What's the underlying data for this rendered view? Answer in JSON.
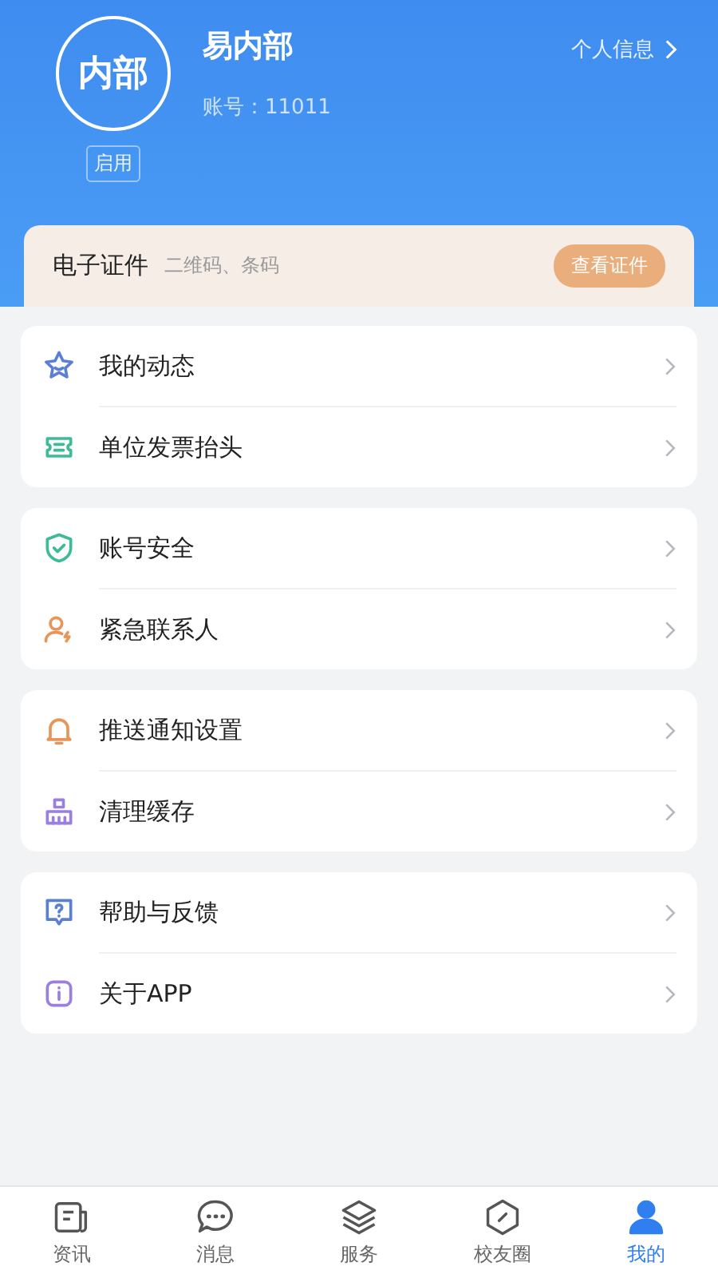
{
  "profile": {
    "avatar_text": "内部",
    "name": "易内部",
    "account": "账号：11011",
    "status": "启用",
    "info_link": "个人信息"
  },
  "id_card": {
    "title": "电子证件",
    "subtitle": "二维码、条码",
    "button": "查看证件"
  },
  "menu_groups": [
    {
      "items": [
        {
          "kind": "star",
          "color": "#5b7fd6",
          "label": "我的动态"
        },
        {
          "kind": "ticket",
          "color": "#3dbb97",
          "label": "单位发票抬头"
        }
      ]
    },
    {
      "items": [
        {
          "kind": "shield",
          "color": "#3dbb97",
          "label": "账号安全"
        },
        {
          "kind": "contact",
          "color": "#e8955a",
          "label": "紧急联系人"
        }
      ]
    },
    {
      "items": [
        {
          "kind": "bell",
          "color": "#e8955a",
          "label": "推送通知设置"
        },
        {
          "kind": "broom",
          "color": "#9a7fe0",
          "label": "清理缓存"
        }
      ]
    },
    {
      "items": [
        {
          "kind": "help",
          "color": "#5b7fd6",
          "label": "帮助与反馈"
        },
        {
          "kind": "info",
          "color": "#9a7fe0",
          "label": "关于APP"
        }
      ]
    }
  ],
  "tabs": [
    {
      "kind": "news",
      "label": "资讯",
      "selected": false
    },
    {
      "kind": "chat",
      "label": "消息",
      "selected": false
    },
    {
      "kind": "layers",
      "label": "服务",
      "selected": false
    },
    {
      "kind": "hex",
      "label": "校友圈",
      "selected": false
    },
    {
      "kind": "person",
      "label": "我的",
      "selected": true
    }
  ]
}
